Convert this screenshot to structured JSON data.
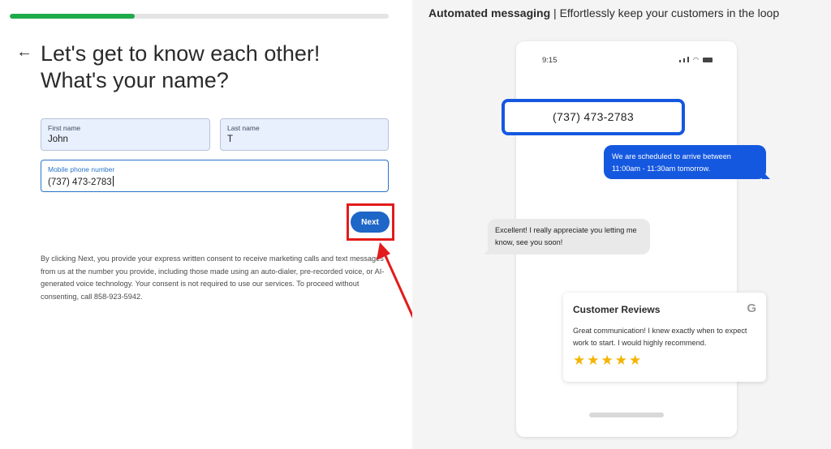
{
  "progress": {
    "fraction": 0.33
  },
  "colors": {
    "brand_blue": "#1e66c7",
    "progress_green": "#1faa4c",
    "highlight_red": "#e31b1b",
    "message_blue": "#1558e0",
    "star_yellow": "#f4b400"
  },
  "form": {
    "back_icon": "←",
    "heading_line1": "Let's get to know each other!",
    "heading_line2": "What's your name?",
    "first_name": {
      "label": "First name",
      "value": "John"
    },
    "last_name": {
      "label": "Last name",
      "value": "T"
    },
    "phone": {
      "label": "Mobile phone number",
      "value": "(737) 473-2783"
    },
    "next_label": "Next",
    "consent": "By clicking Next, you provide your express written consent to receive marketing calls and text messages from us at the number you provide, including those made using an auto-dialer, pre-recorded voice, or AI-generated voice technology. Your consent is not required to use our services. To proceed without consenting, call 858-923-5942."
  },
  "promo": {
    "title_bold": "Automated messaging",
    "title_sep": " | ",
    "title_rest": "Effortlessly keep your customers in the loop",
    "phone_time": "9:15",
    "phone_number_display": "(737) 473-2783",
    "outgoing_message": "We are scheduled to arrive between 11:00am - 11:30am tomorrow.",
    "incoming_message": "Excellent! I really appreciate you letting me know, see you soon!",
    "review": {
      "title": "Customer Reviews",
      "google_icon": "G",
      "text": "Great communication! I knew exactly when to expect work to start. I would highly recommend.",
      "rating": 5,
      "star_glyph": "★"
    }
  }
}
